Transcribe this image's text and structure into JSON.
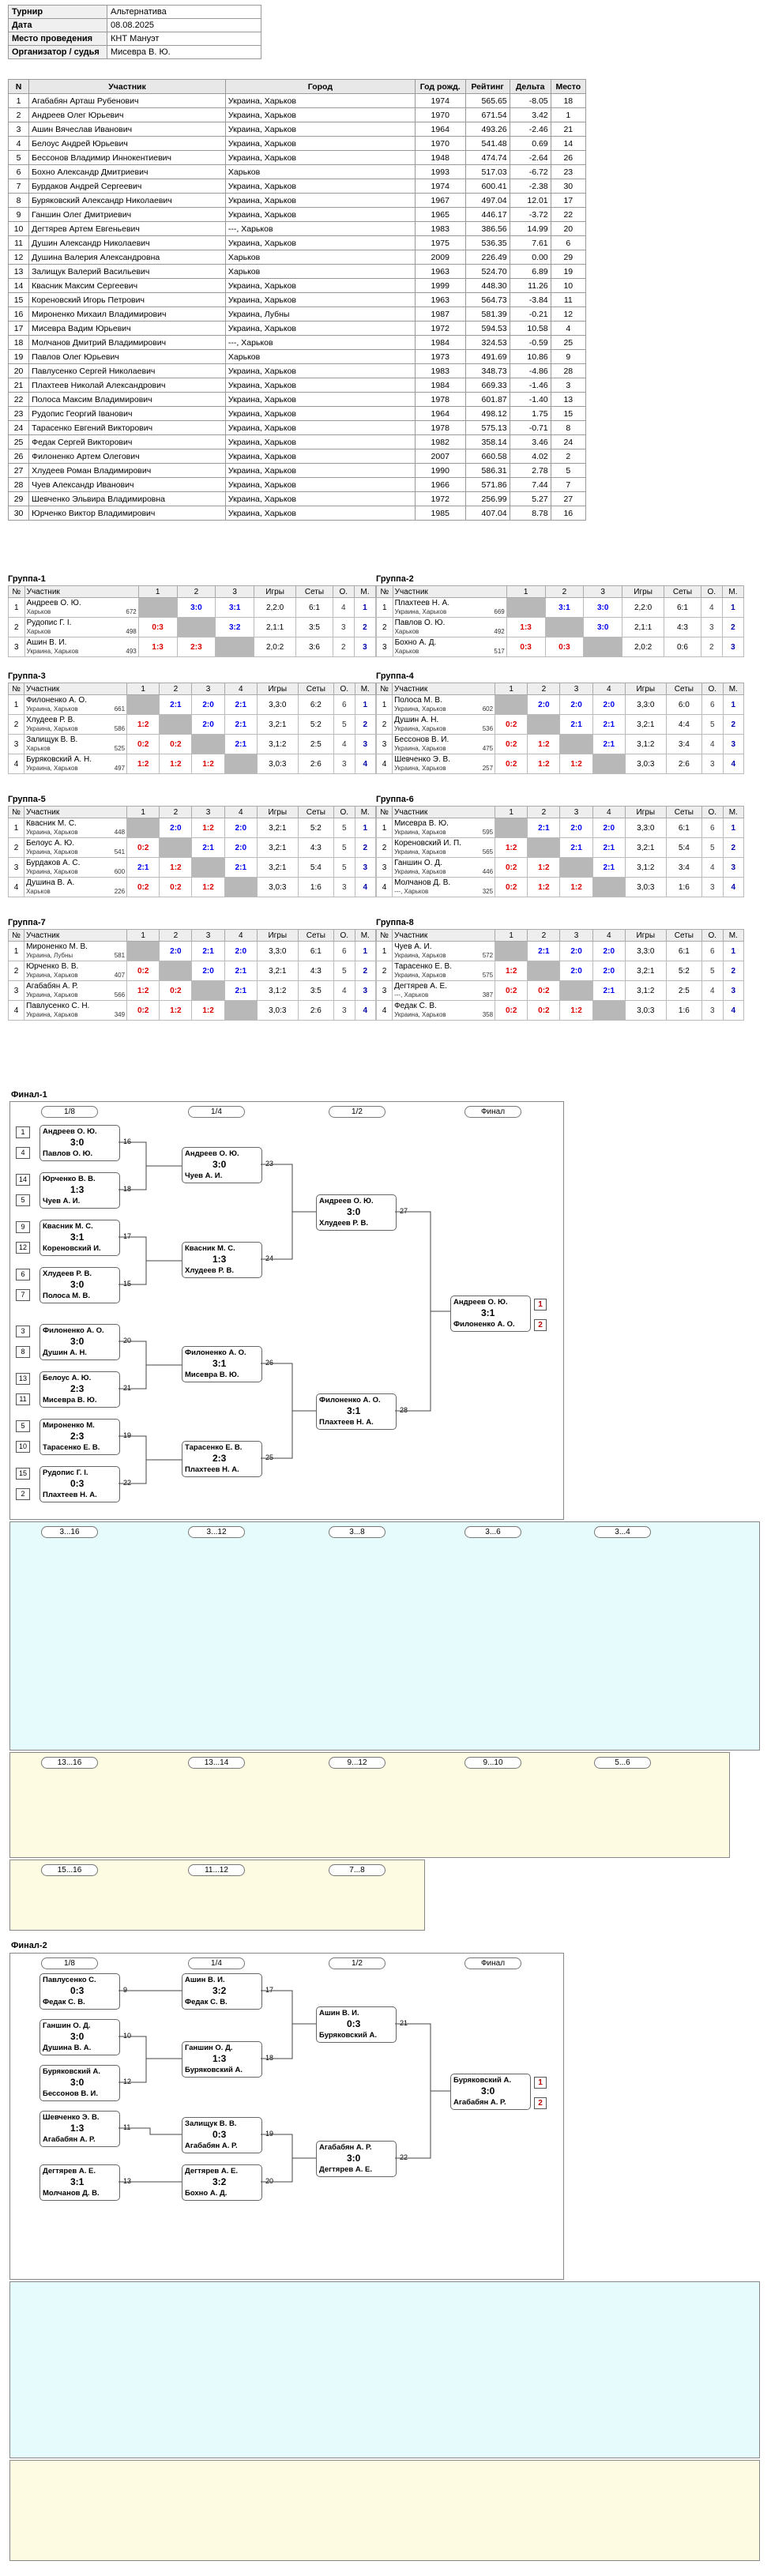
{
  "info": [
    {
      "k": "Турнир",
      "v": "Альтернатива"
    },
    {
      "k": "Дата",
      "v": "08.08.2025"
    },
    {
      "k": "Место проведения",
      "v": "КНТ Мануэт"
    },
    {
      "k": "Организатор / судья",
      "v": "Мисевра В. Ю."
    }
  ],
  "players_headers": [
    "N",
    "Участник",
    "Город",
    "Год рожд.",
    "Рейтинг",
    "Дельта",
    "Место"
  ],
  "players": [
    [
      "1",
      "Агабабян Арташ Рубенович",
      "Украина, Харьков",
      "1974",
      "565.65",
      "-8.05",
      "18"
    ],
    [
      "2",
      "Андреев Олег Юрьевич",
      "Украина, Харьков",
      "1970",
      "671.54",
      "3.42",
      "1"
    ],
    [
      "3",
      "Ашин Вячеслав Иванович",
      "Украина, Харьков",
      "1964",
      "493.26",
      "-2.46",
      "21"
    ],
    [
      "4",
      "Белоус Андрей Юрьевич",
      "Украина, Харьков",
      "1970",
      "541.48",
      "0.69",
      "14"
    ],
    [
      "5",
      "Бессонов Владимир Иннокентиевич",
      "Украина, Харьков",
      "1948",
      "474.74",
      "-2.64",
      "26"
    ],
    [
      "6",
      "Бохно Александр Дмитриевич",
      "Харьков",
      "1993",
      "517.03",
      "-6.72",
      "23"
    ],
    [
      "7",
      "Бурдаков Андрей Сергеевич",
      "Украина, Харьков",
      "1974",
      "600.41",
      "-2.38",
      "30"
    ],
    [
      "8",
      "Буряковский Александр Николаевич",
      "Украина, Харьков",
      "1967",
      "497.04",
      "12.01",
      "17"
    ],
    [
      "9",
      "Ганшин Олег Дмитриевич",
      "Украина, Харьков",
      "1965",
      "446.17",
      "-3.72",
      "22"
    ],
    [
      "10",
      "Дегтярев Артем Евгеньевич",
      "---, Харьков",
      "1983",
      "386.56",
      "14.99",
      "20"
    ],
    [
      "11",
      "Душин Александр Николаевич",
      "Украина, Харьков",
      "1975",
      "536.35",
      "7.61",
      "6"
    ],
    [
      "12",
      "Душина Валерия Александровна",
      "Харьков",
      "2009",
      "226.49",
      "0.00",
      "29"
    ],
    [
      "13",
      "Залищук Валерий Васильевич",
      "Харьков",
      "1963",
      "524.70",
      "6.89",
      "19"
    ],
    [
      "14",
      "Квасник Максим Сергеевич",
      "Украина, Харьков",
      "1999",
      "448.30",
      "11.26",
      "10"
    ],
    [
      "15",
      "Кореновский Игорь Петрович",
      "Украина, Харьков",
      "1963",
      "564.73",
      "-3.84",
      "11"
    ],
    [
      "16",
      "Мироненко Михаил Владимирович",
      "Украина, Лубны",
      "1987",
      "581.39",
      "-0.21",
      "12"
    ],
    [
      "17",
      "Мисевра Вадим Юрьевич",
      "Украина, Харьков",
      "1972",
      "594.53",
      "10.58",
      "4"
    ],
    [
      "18",
      "Молчанов Дмитрий Владимирович",
      "---, Харьков",
      "1984",
      "324.53",
      "-0.59",
      "25"
    ],
    [
      "19",
      "Павлов Олег Юрьевич",
      "Харьков",
      "1973",
      "491.69",
      "10.86",
      "9"
    ],
    [
      "20",
      "Павлусенко Сергей Николаевич",
      "Украина, Харьков",
      "1983",
      "348.73",
      "-4.86",
      "28"
    ],
    [
      "21",
      "Плахтеев Николай Александрович",
      "Украина, Харьков",
      "1984",
      "669.33",
      "-1.46",
      "3"
    ],
    [
      "22",
      "Полоса Максим Владимирович",
      "Украина, Харьков",
      "1978",
      "601.87",
      "-1.40",
      "13"
    ],
    [
      "23",
      "Рудопис Георгий Іванович",
      "Украина, Харьков",
      "1964",
      "498.12",
      "1.75",
      "15"
    ],
    [
      "24",
      "Тарасенко Евгений Викторович",
      "Украина, Харьков",
      "1978",
      "575.13",
      "-0.71",
      "8"
    ],
    [
      "25",
      "Федак Сергей Викторович",
      "Украина, Харьков",
      "1982",
      "358.14",
      "3.46",
      "24"
    ],
    [
      "26",
      "Филоненко Артем Олегович",
      "Украина, Харьков",
      "2007",
      "660.58",
      "4.02",
      "2"
    ],
    [
      "27",
      "Хлудеев Роман Владимирович",
      "Украина, Харьков",
      "1990",
      "586.31",
      "2.78",
      "5"
    ],
    [
      "28",
      "Чуев Александр Иванович",
      "Украина, Харьков",
      "1966",
      "571.86",
      "7.44",
      "7"
    ],
    [
      "29",
      "Шевченко Эльвира Владимировна",
      "Украина, Харьков",
      "1972",
      "256.99",
      "5.27",
      "27"
    ],
    [
      "30",
      "Юрченко Виктор Владимирович",
      "Украина, Харьков",
      "1985",
      "407.04",
      "8.78",
      "16"
    ]
  ],
  "group_headers": {
    "n": "№",
    "name": "Участник",
    "games": "Игры",
    "sets": "Сеты",
    "o": "О.",
    "m": "М."
  },
  "groups": [
    {
      "title": "Группа-1",
      "cols": [
        "1",
        "2",
        "3"
      ],
      "rows": [
        {
          "n": "1",
          "name": "Андреев О. Ю.",
          "city": "Харьков",
          "rt": "672",
          "cells": [
            "",
            "3:0",
            "3:1"
          ],
          "games": "2,2:0",
          "sets": "6:1",
          "o": "4",
          "m": "1"
        },
        {
          "n": "2",
          "name": "Рудопис Г. І.",
          "city": "Харьков",
          "rt": "498",
          "cells": [
            "0:3",
            "",
            "3:2"
          ],
          "games": "2,1:1",
          "sets": "3:5",
          "o": "3",
          "m": "2"
        },
        {
          "n": "3",
          "name": "Ашин В. И.",
          "city": "Украина, Харьков",
          "rt": "493",
          "cells": [
            "1:3",
            "2:3",
            ""
          ],
          "games": "2,0:2",
          "sets": "3:6",
          "o": "2",
          "m": "3"
        }
      ]
    },
    {
      "title": "Группа-2",
      "cols": [
        "1",
        "2",
        "3"
      ],
      "rows": [
        {
          "n": "1",
          "name": "Плахтеев Н. А.",
          "city": "Украина, Харьков",
          "rt": "669",
          "cells": [
            "",
            "3:1",
            "3:0"
          ],
          "games": "2,2:0",
          "sets": "6:1",
          "o": "4",
          "m": "1"
        },
        {
          "n": "2",
          "name": "Павлов О. Ю.",
          "city": "Харьков",
          "rt": "492",
          "cells": [
            "1:3",
            "",
            "3:0"
          ],
          "games": "2,1:1",
          "sets": "4:3",
          "o": "3",
          "m": "2"
        },
        {
          "n": "3",
          "name": "Бохно А. Д.",
          "city": "Харьков",
          "rt": "517",
          "cells": [
            "0:3",
            "0:3",
            ""
          ],
          "games": "2,0:2",
          "sets": "0:6",
          "o": "2",
          "m": "3"
        }
      ]
    },
    {
      "title": "Группа-3",
      "cols": [
        "1",
        "2",
        "3",
        "4"
      ],
      "rows": [
        {
          "n": "1",
          "name": "Филоненко А. О.",
          "city": "Украина, Харьков",
          "rt": "661",
          "cells": [
            "",
            "2:1",
            "2:0",
            "2:1"
          ],
          "games": "3,3:0",
          "sets": "6:2",
          "o": "6",
          "m": "1"
        },
        {
          "n": "2",
          "name": "Хлудеев Р. В.",
          "city": "Украина, Харьков",
          "rt": "586",
          "cells": [
            "1:2",
            "",
            "2:0",
            "2:1"
          ],
          "games": "3,2:1",
          "sets": "5:2",
          "o": "5",
          "m": "2"
        },
        {
          "n": "3",
          "name": "Залищук В. В.",
          "city": "Харьков",
          "rt": "525",
          "cells": [
            "0:2",
            "0:2",
            "",
            "2:1"
          ],
          "games": "3,1:2",
          "sets": "2:5",
          "o": "4",
          "m": "3"
        },
        {
          "n": "4",
          "name": "Буряковский А. Н.",
          "city": "Украина, Харьков",
          "rt": "497",
          "cells": [
            "1:2",
            "1:2",
            "1:2",
            ""
          ],
          "games": "3,0:3",
          "sets": "2:6",
          "o": "3",
          "m": "4"
        }
      ]
    },
    {
      "title": "Группа-4",
      "cols": [
        "1",
        "2",
        "3",
        "4"
      ],
      "rows": [
        {
          "n": "1",
          "name": "Полоса М. В.",
          "city": "Украина, Харьков",
          "rt": "602",
          "cells": [
            "",
            "2:0",
            "2:0",
            "2:0"
          ],
          "games": "3,3:0",
          "sets": "6:0",
          "o": "6",
          "m": "1"
        },
        {
          "n": "2",
          "name": "Душин А. Н.",
          "city": "Украина, Харьков",
          "rt": "536",
          "cells": [
            "0:2",
            "",
            "2:1",
            "2:1"
          ],
          "games": "3,2:1",
          "sets": "4:4",
          "o": "5",
          "m": "2"
        },
        {
          "n": "3",
          "name": "Бессонов В. И.",
          "city": "Украина, Харьков",
          "rt": "475",
          "cells": [
            "0:2",
            "1:2",
            "",
            "2:1"
          ],
          "games": "3,1:2",
          "sets": "3:4",
          "o": "4",
          "m": "3"
        },
        {
          "n": "4",
          "name": "Шевченко Э. В.",
          "city": "Украина, Харьков",
          "rt": "257",
          "cells": [
            "0:2",
            "1:2",
            "1:2",
            ""
          ],
          "games": "3,0:3",
          "sets": "2:6",
          "o": "3",
          "m": "4"
        }
      ]
    },
    {
      "title": "Группа-5",
      "cols": [
        "1",
        "2",
        "3",
        "4"
      ],
      "rows": [
        {
          "n": "1",
          "name": "Квасник М. С.",
          "city": "Украина, Харьков",
          "rt": "448",
          "cells": [
            "",
            "2:0",
            "1:2",
            "2:0"
          ],
          "games": "3,2:1",
          "sets": "5:2",
          "o": "5",
          "m": "1"
        },
        {
          "n": "2",
          "name": "Белоус А. Ю.",
          "city": "Украина, Харьков",
          "rt": "541",
          "cells": [
            "0:2",
            "",
            "2:1",
            "2:0"
          ],
          "games": "3,2:1",
          "sets": "4:3",
          "o": "5",
          "m": "2"
        },
        {
          "n": "3",
          "name": "Бурдаков А. С.",
          "city": "Украина, Харьков",
          "rt": "600",
          "cells": [
            "2:1",
            "1:2",
            "",
            "2:1"
          ],
          "games": "3,2:1",
          "sets": "5:4",
          "o": "5",
          "m": "3"
        },
        {
          "n": "4",
          "name": "Душина В. А.",
          "city": "Харьков",
          "rt": "226",
          "cells": [
            "0:2",
            "0:2",
            "1:2",
            ""
          ],
          "games": "3,0:3",
          "sets": "1:6",
          "o": "3",
          "m": "4"
        }
      ]
    },
    {
      "title": "Группа-6",
      "cols": [
        "1",
        "2",
        "3",
        "4"
      ],
      "rows": [
        {
          "n": "1",
          "name": "Мисевра В. Ю.",
          "city": "Украина, Харьков",
          "rt": "595",
          "cells": [
            "",
            "2:1",
            "2:0",
            "2:0"
          ],
          "games": "3,3:0",
          "sets": "6:1",
          "o": "6",
          "m": "1"
        },
        {
          "n": "2",
          "name": "Кореновский И. П.",
          "city": "Украина, Харьков",
          "rt": "565",
          "cells": [
            "1:2",
            "",
            "2:1",
            "2:1"
          ],
          "games": "3,2:1",
          "sets": "5:4",
          "o": "5",
          "m": "2"
        },
        {
          "n": "3",
          "name": "Ганшин О. Д.",
          "city": "Украина, Харьков",
          "rt": "446",
          "cells": [
            "0:2",
            "1:2",
            "",
            "2:1"
          ],
          "games": "3,1:2",
          "sets": "3:4",
          "o": "4",
          "m": "3"
        },
        {
          "n": "4",
          "name": "Молчанов Д. В.",
          "city": "---, Харьков",
          "rt": "325",
          "cells": [
            "0:2",
            "1:2",
            "1:2",
            ""
          ],
          "games": "3,0:3",
          "sets": "1:6",
          "o": "3",
          "m": "4"
        }
      ]
    },
    {
      "title": "Группа-7",
      "cols": [
        "1",
        "2",
        "3",
        "4"
      ],
      "rows": [
        {
          "n": "1",
          "name": "Мироненко М. В.",
          "city": "Украина, Лубны",
          "rt": "581",
          "cells": [
            "",
            "2:0",
            "2:1",
            "2:0"
          ],
          "games": "3,3:0",
          "sets": "6:1",
          "o": "6",
          "m": "1"
        },
        {
          "n": "2",
          "name": "Юрченко В. В.",
          "city": "Украина, Харьков",
          "rt": "407",
          "cells": [
            "0:2",
            "",
            "2:0",
            "2:1"
          ],
          "games": "3,2:1",
          "sets": "4:3",
          "o": "5",
          "m": "2"
        },
        {
          "n": "3",
          "name": "Агабабян А. Р.",
          "city": "Украина, Харьков",
          "rt": "566",
          "cells": [
            "1:2",
            "0:2",
            "",
            "2:1"
          ],
          "games": "3,1:2",
          "sets": "3:5",
          "o": "4",
          "m": "3"
        },
        {
          "n": "4",
          "name": "Павлусенко С. Н.",
          "city": "Украина, Харьков",
          "rt": "349",
          "cells": [
            "0:2",
            "1:2",
            "1:2",
            ""
          ],
          "games": "3,0:3",
          "sets": "2:6",
          "o": "3",
          "m": "4"
        }
      ]
    },
    {
      "title": "Группа-8",
      "cols": [
        "1",
        "2",
        "3",
        "4"
      ],
      "rows": [
        {
          "n": "1",
          "name": "Чуев А. И.",
          "city": "Украина, Харьков",
          "rt": "572",
          "cells": [
            "",
            "2:1",
            "2:0",
            "2:0"
          ],
          "games": "3,3:0",
          "sets": "6:1",
          "o": "6",
          "m": "1"
        },
        {
          "n": "2",
          "name": "Тарасенко Е. В.",
          "city": "Украина, Харьков",
          "rt": "575",
          "cells": [
            "1:2",
            "",
            "2:0",
            "2:0"
          ],
          "games": "3,2:1",
          "sets": "5:2",
          "o": "5",
          "m": "2"
        },
        {
          "n": "3",
          "name": "Дегтярев А. Е.",
          "city": "---, Харьков",
          "rt": "387",
          "cells": [
            "0:2",
            "0:2",
            "",
            "2:1"
          ],
          "games": "3,1:2",
          "sets": "2:5",
          "o": "4",
          "m": "3"
        },
        {
          "n": "4",
          "name": "Федак С. В.",
          "city": "Украина, Харьков",
          "rt": "358",
          "cells": [
            "0:2",
            "0:2",
            "1:2",
            ""
          ],
          "games": "3,0:3",
          "sets": "1:6",
          "o": "3",
          "m": "4"
        }
      ]
    }
  ],
  "final1": {
    "title": "Финал-1",
    "stages_main": [
      "1/8",
      "1/4",
      "1/2",
      "Финал"
    ],
    "stages_c1": [
      "3...16",
      "3...12",
      "3...8",
      "3...6",
      "3...4"
    ],
    "stages_c2": [
      "13...16",
      "13...14",
      "9...12",
      "9...10",
      "5...6"
    ],
    "stages_c3": [
      "15...16",
      "11...12",
      "7...8"
    ],
    "r16": [
      {
        "a": "Андреев О. Ю.",
        "b": "Павлов О. Ю.",
        "s": "3:0",
        "no": "16",
        "sa": "1",
        "sb": "4"
      },
      {
        "a": "Юрченко В. В.",
        "b": "Чуев А. И.",
        "s": "1:3",
        "no": "18",
        "sa": "14",
        "sb": "5"
      },
      {
        "a": "Квасник М. С.",
        "b": "Кореновский И.",
        "s": "3:1",
        "no": "17",
        "sa": "9",
        "sb": "12"
      },
      {
        "a": "Хлудеев Р. В.",
        "b": "Полоса М. В.",
        "s": "3:0",
        "no": "15",
        "sa": "6",
        "sb": "7"
      },
      {
        "a": "Филоненко А. О.",
        "b": "Душин А. Н.",
        "s": "3:0",
        "no": "20",
        "sa": "3",
        "sb": "8"
      },
      {
        "a": "Белоус А. Ю.",
        "b": "Мисевра В. Ю.",
        "s": "2:3",
        "no": "21",
        "sa": "13",
        "sb": "11"
      },
      {
        "a": "Мироненко М.",
        "b": "Тарасенко Е. В.",
        "s": "2:3",
        "no": "19",
        "sa": "5",
        "sb": "10"
      },
      {
        "a": "Рудопис Г. І.",
        "b": "Плахтеев Н. А.",
        "s": "0:3",
        "no": "22",
        "sa": "15",
        "sb": "2"
      }
    ],
    "qf": [
      {
        "a": "Андреев О. Ю.",
        "b": "Чуев А. И.",
        "s": "3:0",
        "no": "23"
      },
      {
        "a": "Квасник М. С.",
        "b": "Хлудеев Р. В.",
        "s": "1:3",
        "no": "24"
      },
      {
        "a": "Филоненко А. О.",
        "b": "Мисевра В. Ю.",
        "s": "3:1",
        "no": "26"
      },
      {
        "a": "Тарасенко Е. В.",
        "b": "Плахтеев Н. А.",
        "s": "2:3",
        "no": "25"
      }
    ],
    "sf": [
      {
        "a": "Андреев О. Ю.",
        "b": "Хлудеев Р. В.",
        "s": "3:0",
        "no": "27"
      },
      {
        "a": "Филоненко А. О.",
        "b": "Плахтеев Н. А.",
        "s": "3:1",
        "no": "28"
      }
    ],
    "fin": {
      "a": "Андреев О. Ю.",
      "b": "Филоненко А. О.",
      "s": "3:1",
      "ra": "1",
      "rb": "2"
    }
  },
  "final2": {
    "title": "Финал-2",
    "stages_main": [
      "1/8",
      "1/4",
      "1/2",
      "Финал"
    ],
    "r16": [
      {
        "a": "Павлусенко С.",
        "b": "Федак С. В.",
        "s": "0:3",
        "no": "9"
      },
      {
        "a": "Ганшин О. Д.",
        "b": "Душина В. А.",
        "s": "3:0",
        "no": "10"
      },
      {
        "a": "Буряковский А.",
        "b": "Бессонов В. И.",
        "s": "3:0",
        "no": "12"
      },
      {
        "a": "Шевченко Э. В.",
        "b": "Агабабян А. Р.",
        "s": "1:3",
        "no": "11"
      },
      {
        "a": "Дегтярев А. Е.",
        "b": "Молчанов Д. В.",
        "s": "3:1",
        "no": "13"
      }
    ],
    "qf": [
      {
        "a": "Ашин В. И.",
        "b": "Федак С. В.",
        "s": "3:2",
        "no": "17"
      },
      {
        "a": "Ганшин О. Д.",
        "b": "Буряковский А.",
        "s": "1:3",
        "no": "18"
      },
      {
        "a": "Залищук В. В.",
        "b": "Агабабян А. Р.",
        "s": "0:3",
        "no": "19"
      },
      {
        "a": "Дегтярев А. Е.",
        "b": "Бохно А. Д.",
        "s": "3:2",
        "no": "20"
      }
    ],
    "sf": [
      {
        "a": "Ашин В. И.",
        "b": "Буряковский А.",
        "s": "0:3",
        "no": "21"
      },
      {
        "a": "Агабабян А. Р.",
        "b": "Дегтярев А. Е.",
        "s": "3:0",
        "no": "22"
      }
    ],
    "fin": {
      "a": "Буряковский А.",
      "b": "Агабабян А. Р.",
      "s": "3:0",
      "ra": "1",
      "rb": "2"
    }
  }
}
